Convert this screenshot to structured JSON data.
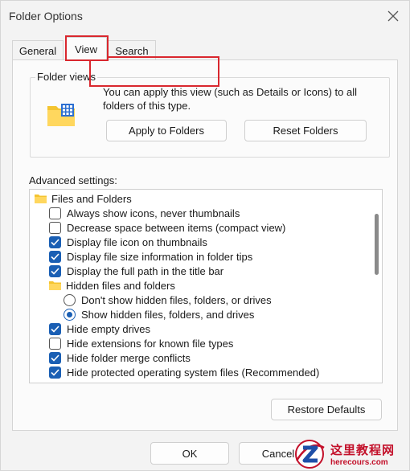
{
  "window": {
    "title": "Folder Options"
  },
  "tabs": [
    {
      "label": "General",
      "active": false
    },
    {
      "label": "View",
      "active": true
    },
    {
      "label": "Search",
      "active": false
    }
  ],
  "folder_views": {
    "label": "Folder views",
    "description": "You can apply this view (such as Details or Icons) to all folders of this type.",
    "apply_label": "Apply to Folders",
    "reset_label": "Reset Folders"
  },
  "advanced": {
    "label": "Advanced settings:",
    "items": [
      {
        "type": "folder",
        "label": "Files and Folders",
        "level": 0
      },
      {
        "type": "checkbox",
        "label": "Always show icons, never thumbnails",
        "checked": false,
        "level": 1
      },
      {
        "type": "checkbox",
        "label": "Decrease space between items (compact view)",
        "checked": false,
        "level": 1
      },
      {
        "type": "checkbox",
        "label": "Display file icon on thumbnails",
        "checked": true,
        "level": 1
      },
      {
        "type": "checkbox",
        "label": "Display file size information in folder tips",
        "checked": true,
        "level": 1
      },
      {
        "type": "checkbox",
        "label": "Display the full path in the title bar",
        "checked": true,
        "level": 1
      },
      {
        "type": "folder",
        "label": "Hidden files and folders",
        "level": 1
      },
      {
        "type": "radio",
        "label": "Don't show hidden files, folders, or drives",
        "checked": false,
        "level": 2
      },
      {
        "type": "radio",
        "label": "Show hidden files, folders, and drives",
        "checked": true,
        "level": 2
      },
      {
        "type": "checkbox",
        "label": "Hide empty drives",
        "checked": true,
        "level": 1
      },
      {
        "type": "checkbox",
        "label": "Hide extensions for known file types",
        "checked": false,
        "level": 1
      },
      {
        "type": "checkbox",
        "label": "Hide folder merge conflicts",
        "checked": true,
        "level": 1
      },
      {
        "type": "checkbox",
        "label": "Hide protected operating system files (Recommended)",
        "checked": true,
        "level": 1
      }
    ]
  },
  "buttons": {
    "restore_defaults": "Restore Defaults",
    "ok": "OK",
    "cancel": "Cancel"
  },
  "watermark": {
    "site_name": "这里教程网",
    "url": "herecours.com"
  },
  "colors": {
    "accent": "#1a5fb4",
    "highlight": "#d9272e",
    "watermark": "#c3102a"
  }
}
